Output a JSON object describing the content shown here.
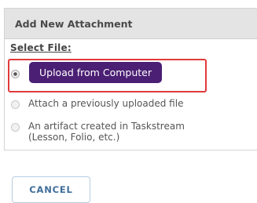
{
  "dialog": {
    "title": "Add New Attachment",
    "select_label": "Select File:",
    "options": [
      {
        "label": "Upload from Computer",
        "selected": true
      },
      {
        "label": "Attach a previously uploaded file",
        "selected": false
      },
      {
        "label_line1": "An artifact created in Taskstream",
        "label_line2": "(Lesson, Folio, etc.)",
        "selected": false
      }
    ],
    "cancel_label": "CANCEL"
  },
  "colors": {
    "upload_button_bg": "#4b1f74",
    "highlight_border": "#e03b3b",
    "cancel_text": "#3f6e9a"
  }
}
